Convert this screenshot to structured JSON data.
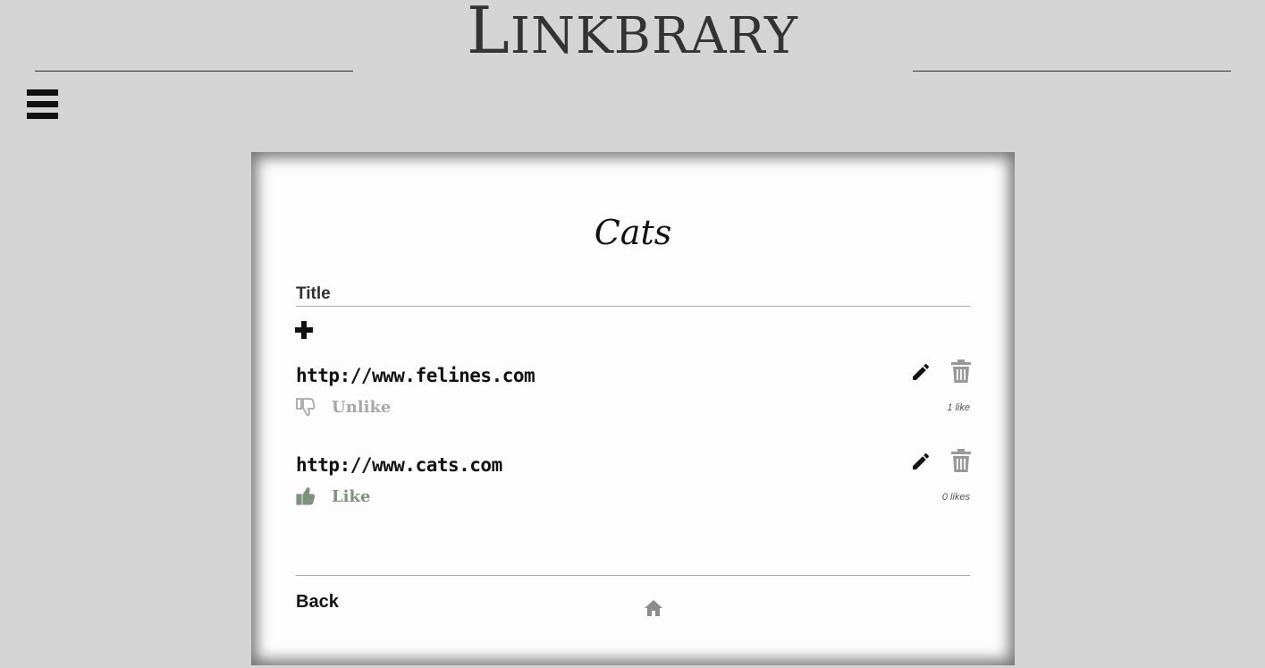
{
  "header": {
    "logo_first": "L",
    "logo_rest": "INKBRARY"
  },
  "collection": {
    "title": "Cats",
    "new_link_placeholder": "Title"
  },
  "links": [
    {
      "url": "http://www.felines.com",
      "vote_label": "Unlike",
      "vote_icon": "thumbs-down-icon",
      "likes_text": "1 like"
    },
    {
      "url": "http://www.cats.com",
      "vote_label": "Like",
      "vote_icon": "thumbs-up-icon",
      "likes_text": "0 likes"
    }
  ],
  "footer": {
    "back_label": "Back"
  },
  "colors": {
    "page_bg": "#d4d4d4",
    "card_bg": "#fdfdfd",
    "unlike_gray": "#a8a8a8",
    "like_green": "#7f927f",
    "trash_gray": "#999999",
    "home_gray": "#8c8c8c"
  }
}
